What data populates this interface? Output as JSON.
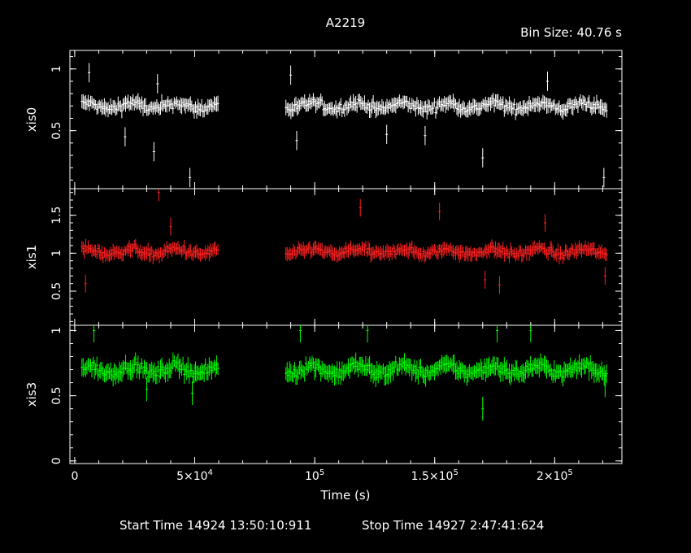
{
  "title": "A2219",
  "bin_size": "Bin Size: 40.76 s",
  "start_time": "Start Time 14924 13:50:10:911",
  "stop_time": "Stop Time 14927  2:47:41:624",
  "x_axis": {
    "label": "Time (s)",
    "range": [
      -2000,
      228000
    ],
    "ticks": [
      {
        "value": 0,
        "label": "0"
      },
      {
        "value": 50000,
        "label": "5×10"
      },
      {
        "value": 100000,
        "label": "10"
      },
      {
        "value": 150000,
        "label": "1.5×10"
      },
      {
        "value": 200000,
        "label": "2×10"
      }
    ],
    "tick_exponents": [
      "",
      "4",
      "5",
      "5",
      "5"
    ]
  },
  "colors": {
    "xis0": "#ffffff",
    "xis1": "#ff2020",
    "xis3": "#00ff00",
    "axes": "#ffffff",
    "background": "#000000"
  },
  "chart_data": [
    {
      "type": "scatter",
      "panel": "xis0",
      "ylabel": "xis0",
      "ylim": [
        0.03,
        1.15
      ],
      "yticks": [
        {
          "value": 0.5,
          "label": "0.5"
        },
        {
          "value": 1,
          "label": "1"
        }
      ],
      "segments": [
        [
          3000,
          60000
        ],
        [
          88000,
          222000
        ]
      ],
      "mean": 0.7,
      "spread": 0.06,
      "outliers": [
        [
          6000,
          0.97
        ],
        [
          21000,
          0.45
        ],
        [
          33000,
          0.33
        ],
        [
          34500,
          0.88
        ],
        [
          48000,
          0.12
        ],
        [
          90000,
          0.95
        ],
        [
          92500,
          0.42
        ],
        [
          130000,
          0.47
        ],
        [
          146000,
          0.46
        ],
        [
          170000,
          0.28
        ],
        [
          197000,
          0.9
        ],
        [
          220500,
          0.12
        ]
      ]
    },
    {
      "type": "scatter",
      "panel": "xis1",
      "ylabel": "xis1",
      "ylim": [
        0.05,
        1.85
      ],
      "yticks": [
        {
          "value": 0.5,
          "label": "0.5"
        },
        {
          "value": 1,
          "label": "1"
        },
        {
          "value": 1.5,
          "label": "1.5"
        }
      ],
      "segments": [
        [
          3000,
          60000
        ],
        [
          88000,
          222000
        ]
      ],
      "mean": 1.02,
      "spread": 0.09,
      "outliers": [
        [
          4500,
          0.6
        ],
        [
          35000,
          1.8
        ],
        [
          40000,
          1.35
        ],
        [
          119000,
          1.6
        ],
        [
          152000,
          1.55
        ],
        [
          171000,
          0.65
        ],
        [
          177000,
          0.58
        ],
        [
          196000,
          1.4
        ],
        [
          221000,
          0.7
        ]
      ]
    },
    {
      "type": "scatter",
      "panel": "xis3",
      "ylabel": "xis3",
      "ylim": [
        -0.02,
        1.04
      ],
      "yticks": [
        {
          "value": 0,
          "label": "0"
        },
        {
          "value": 0.5,
          "label": "0.5"
        },
        {
          "value": 1,
          "label": "1"
        }
      ],
      "segments": [
        [
          3000,
          60000
        ],
        [
          88000,
          222000
        ]
      ],
      "mean": 0.7,
      "spread": 0.07,
      "outliers": [
        [
          8000,
          1.0
        ],
        [
          30000,
          0.55
        ],
        [
          49000,
          0.52
        ],
        [
          94000,
          1.0
        ],
        [
          122000,
          1.0
        ],
        [
          170000,
          0.4
        ],
        [
          176000,
          1.0
        ],
        [
          190000,
          1.0
        ],
        [
          221000,
          0.58
        ]
      ]
    }
  ]
}
